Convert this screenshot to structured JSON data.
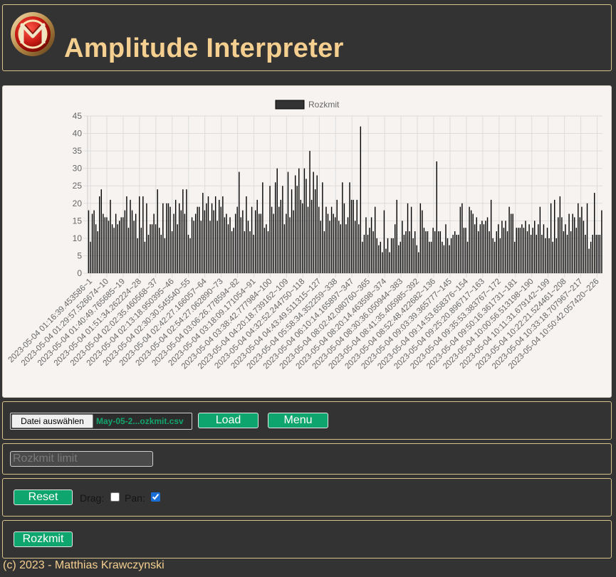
{
  "header": {
    "title": "Amplitude Interpreter",
    "logo_icon": "mk-logo-icon"
  },
  "chart_data": {
    "type": "bar",
    "legend": [
      "Rozkmit"
    ],
    "legend_position": "top",
    "series_color": "#000000",
    "grid": true,
    "ylim": [
      0,
      45
    ],
    "yticks": [
      0,
      5,
      10,
      15,
      20,
      25,
      30,
      35,
      40,
      45
    ],
    "tick_labels": [
      "2023-05-04 01:16:39.453586~1",
      "2023-05-04 01:29:57.526674~10",
      "2023-05-04 01:40:49.765685~19",
      "2023-05-04 01:51:34.262224~28",
      "2023-05-04 02:02:35.460568~37",
      "2023-05-04 02:13:18.950395~46",
      "2023-05-04 02:30:30.545540~55",
      "2023-05-04 02:42:27.166057~64",
      "2023-05-04 02:54:27.062890~73",
      "2023-05-04 03:06:26.778594~82",
      "2023-05-04 03:18:09.171054~91",
      "2023-05-04 03:38:42.777984~100",
      "2023-05-04 04:20:18.739162~109",
      "2023-05-04 04:32:52.244750~118",
      "2023-05-04 04:43:49.511315~127",
      "2023-05-04 05:58:34.352259~338",
      "2023-05-04 06:10:14.165897~347",
      "2023-05-04 08:02:42.080760~365",
      "2023-05-04 08:20:14.463598~374",
      "2023-05-04 08:30:36.050944~383",
      "2023-05-04 08:41:35.405985~392",
      "2023-05-04 08:52:48.422682~136",
      "2023-05-04 09:03:39.365777~145",
      "2023-05-04 09:14:53.658376~154",
      "2023-05-04 09:25:20.896717~163",
      "2023-05-04 09:35:53.383767~172",
      "2023-05-04 09:50:16.361731~181",
      "2023-05-04 10:00:56.513198~190",
      "2023-05-04 10:11:31.679142~199",
      "2023-05-04 10:22:21.524461~208",
      "2023-05-04 10:33:18.707967~217",
      "2023-05-04 10:50:42.057420~226"
    ],
    "values": [
      18,
      9,
      17,
      18,
      14,
      12,
      22,
      24,
      17,
      16,
      16,
      15,
      21,
      14,
      13,
      17,
      14,
      15,
      16,
      16,
      18,
      22,
      13,
      21,
      18,
      15,
      17,
      10,
      22,
      13,
      22,
      9,
      20,
      11,
      14,
      14,
      17,
      14,
      24,
      13,
      11,
      20,
      10,
      20,
      20,
      19,
      12,
      17,
      21,
      14,
      20,
      18,
      24,
      17,
      24,
      11,
      10,
      16,
      15,
      17,
      19,
      19,
      15,
      23,
      18,
      20,
      22,
      15,
      20,
      18,
      22,
      15,
      21,
      19,
      22,
      16,
      17,
      14,
      16,
      12,
      13,
      17,
      19,
      29,
      16,
      18,
      12,
      22,
      15,
      12,
      19,
      11,
      18,
      21,
      17,
      17,
      26,
      13,
      14,
      12,
      25,
      19,
      17,
      26,
      30,
      19,
      21,
      25,
      14,
      17,
      29,
      16,
      24,
      18,
      28,
      25,
      30,
      21,
      20,
      30,
      27,
      19,
      35,
      21,
      29,
      24,
      28,
      19,
      15,
      26,
      12,
      19,
      17,
      15,
      19,
      17,
      16,
      21,
      15,
      14,
      26,
      20,
      14,
      16,
      26,
      21,
      21,
      15,
      21,
      14,
      42,
      9,
      11,
      16,
      11,
      13,
      16,
      12,
      19,
      10,
      8,
      9,
      6,
      18,
      7,
      10,
      6,
      10,
      10,
      14,
      21,
      8,
      9,
      15,
      11,
      12,
      20,
      12,
      19,
      10,
      12,
      8,
      6,
      20,
      18,
      13,
      12,
      12,
      9,
      9,
      13,
      12,
      32,
      12,
      12,
      9,
      8,
      14,
      10,
      8,
      10,
      11,
      12,
      11,
      11,
      19,
      20,
      13,
      13,
      9,
      19,
      18,
      17,
      14,
      16,
      12,
      14,
      15,
      14,
      15,
      16,
      12,
      21,
      10,
      9,
      12,
      14,
      10,
      15,
      13,
      15,
      12,
      19,
      17,
      17,
      9,
      13,
      13,
      13,
      14,
      13,
      15,
      12,
      14,
      11,
      13,
      15,
      11,
      14,
      19,
      11,
      14,
      10,
      13,
      10,
      20,
      9,
      21,
      10,
      16,
      22,
      16,
      12,
      14,
      11,
      17,
      12,
      17,
      16,
      13,
      20,
      16,
      19,
      15,
      11,
      20,
      7,
      9,
      11,
      23,
      11,
      11,
      11,
      18
    ]
  },
  "file": {
    "button_label": "Datei auswählen",
    "file_name": "May-05-2...ozkmit.csv"
  },
  "buttons": {
    "load": "Load",
    "menu": "Menu",
    "reset": "Reset",
    "rozkmit": "Rozkmit"
  },
  "limit": {
    "placeholder": "Rozkmit limit",
    "value": ""
  },
  "controls": {
    "drag_label": "Drag:",
    "drag_checked": false,
    "pan_label": "Pan:",
    "pan_checked": true
  },
  "footer": {
    "text": "(c) 2023 - Matthias Krawczynski"
  }
}
